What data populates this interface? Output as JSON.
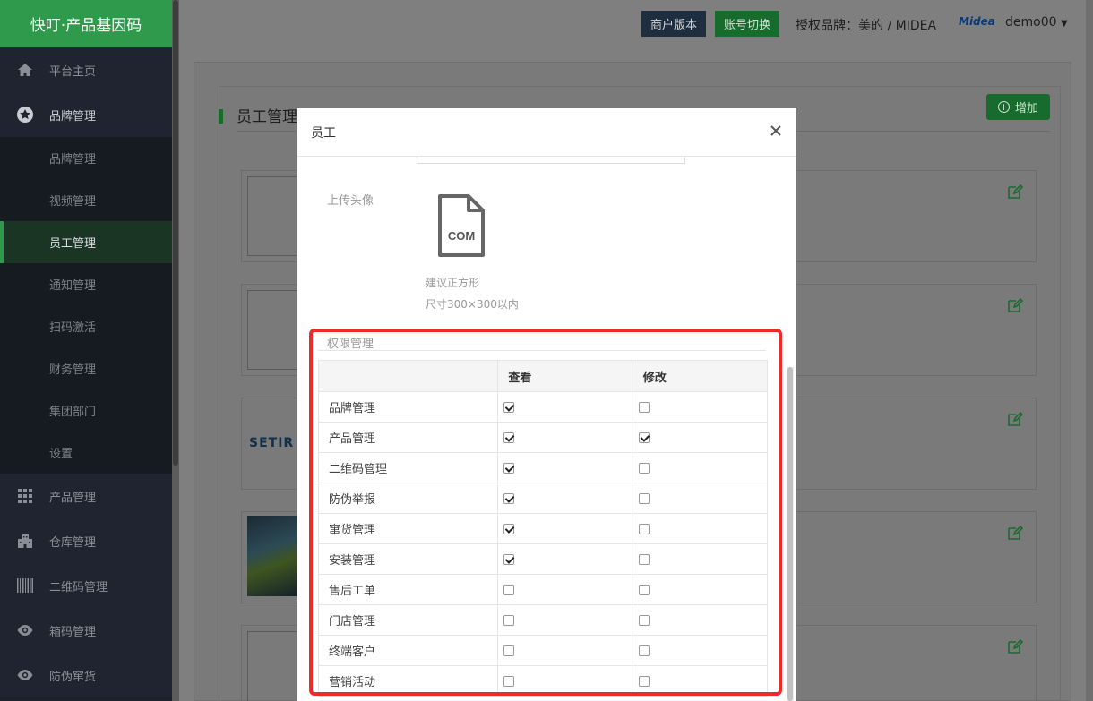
{
  "app": {
    "title": "快叮·产品基因码"
  },
  "sidebar": {
    "items": [
      {
        "label": "平台主页",
        "icon": "home-icon"
      },
      {
        "label": "品牌管理",
        "icon": "star-icon",
        "open": true,
        "children": [
          {
            "label": "品牌管理"
          },
          {
            "label": "视频管理"
          },
          {
            "label": "员工管理",
            "active": true
          },
          {
            "label": "通知管理"
          },
          {
            "label": "扫码激活"
          },
          {
            "label": "财务管理"
          },
          {
            "label": "集团部门"
          },
          {
            "label": "设置"
          }
        ]
      },
      {
        "label": "产品管理",
        "icon": "grid-icon"
      },
      {
        "label": "仓库管理",
        "icon": "building-icon"
      },
      {
        "label": "二维码管理",
        "icon": "qrcode-icon"
      },
      {
        "label": "箱码管理",
        "icon": "eye-icon"
      },
      {
        "label": "防伪窜货",
        "icon": "eye-icon"
      }
    ]
  },
  "topbar": {
    "merchant_label": "商户版本",
    "switch_label": "账号切换",
    "brand_info": "授权品牌：美的 / MIDEA",
    "brand_logo": "Midea",
    "user": "demo00"
  },
  "main": {
    "section_title": "员工管理",
    "add_label": "增加",
    "card_logo_text": "SETIR"
  },
  "modal": {
    "title": "员工",
    "upload_label": "上传头像",
    "file_icon_text": "COM",
    "hint_line1": "建议正方形",
    "hint_line2": "尺寸300×300以内",
    "permissions_label": "权限管理",
    "columns": [
      "",
      "查看",
      "修改"
    ],
    "rows": [
      {
        "name": "品牌管理",
        "view": true,
        "edit": false
      },
      {
        "name": "产品管理",
        "view": true,
        "edit": true
      },
      {
        "name": "二维码管理",
        "view": true,
        "edit": false
      },
      {
        "name": "防伪举报",
        "view": true,
        "edit": false
      },
      {
        "name": "窜货管理",
        "view": true,
        "edit": false
      },
      {
        "name": "安装管理",
        "view": true,
        "edit": false
      },
      {
        "name": "售后工单",
        "view": false,
        "edit": false
      },
      {
        "name": "门店管理",
        "view": false,
        "edit": false
      },
      {
        "name": "终端客户",
        "view": false,
        "edit": false
      },
      {
        "name": "营销活动",
        "view": false,
        "edit": false
      }
    ]
  },
  "colors": {
    "brand_green": "#2f9a4b",
    "highlight_red": "#ee2a2a"
  }
}
